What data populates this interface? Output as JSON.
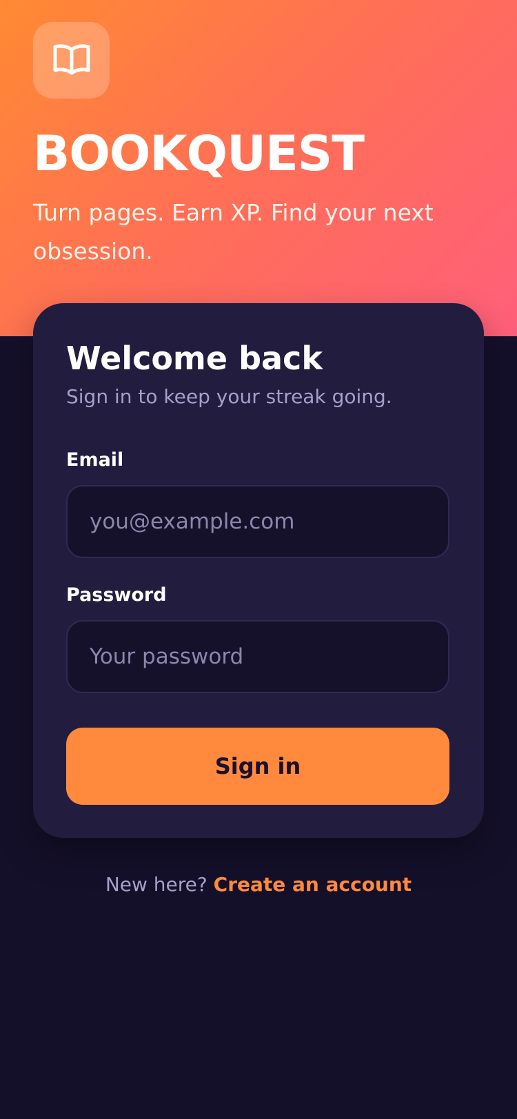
{
  "brand": {
    "logo_icon": "open-book-icon",
    "title": "BOOKQUEST",
    "tagline": "Turn pages. Earn XP. Find your next obsession."
  },
  "login_card": {
    "title": "Welcome back",
    "subtitle": "Sign in to keep your streak going.",
    "email": {
      "label": "Email",
      "value": "",
      "placeholder": "you@example.com"
    },
    "password": {
      "label": "Password",
      "value": "",
      "placeholder": "Your password"
    },
    "submit_label": "Sign in"
  },
  "signup": {
    "prompt": "New here?",
    "link_label": "Create an account"
  },
  "colors": {
    "hero_gradient_start": "#ff8a32",
    "hero_gradient_end": "#ff5f7a",
    "background": "#15102a",
    "card_background": "#221c3f",
    "accent": "#ff8a3d"
  }
}
